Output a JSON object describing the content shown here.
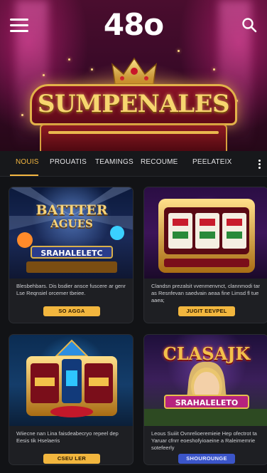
{
  "header": {
    "brand": "48o",
    "hero_title": "SUMPENALES"
  },
  "tabs": [
    {
      "label": "NOUIS",
      "active": true
    },
    {
      "label": "PROUATIS",
      "active": false
    },
    {
      "label": "TEAMINGS",
      "active": false
    },
    {
      "label": "RECOUME",
      "active": false
    },
    {
      "label": "PEELATEIX",
      "active": false
    }
  ],
  "cards": [
    {
      "art_title_line1": "BATTTER",
      "art_title_line2": "AGUES",
      "art_plaque": "SRAHALELETC",
      "description": "Blesbehbars. Dis bsdier ansce fuscere ar genr Lse Reqnsiel orcemer tbeiee.",
      "button_label": "SO AGGA",
      "button_color": "#f2b63e"
    },
    {
      "description": "Clandsn prezalsit vvenmenvnct, clannmodi tar as Resnfevan saedvain aeaa fine Limsd fl tue aaea;",
      "button_label": "JUGIT EEVPEL",
      "button_color": "#f2b63e"
    },
    {
      "description": "Wiiecne nan Lina faisdeabecryo repeel dep Eesis tik Hselaeris",
      "button_label": "CSEU LER",
      "button_color": "#f2b63e"
    },
    {
      "art_title": "CLASAJK",
      "art_plaque": "SRAHALELETO",
      "description": "Leous Suiiit Ovnrelioeremieie Hep ofectrot ta Yaruar cfnrr eoeshofyioaeine a Raleimemrie sotefeerly",
      "button_label": "SHOUROUNGE",
      "button_color": "#3b55c9"
    }
  ],
  "colors": {
    "accent": "#f3b640",
    "background": "#121316",
    "card": "#1e1f23",
    "hero": "#4a0d2e"
  }
}
